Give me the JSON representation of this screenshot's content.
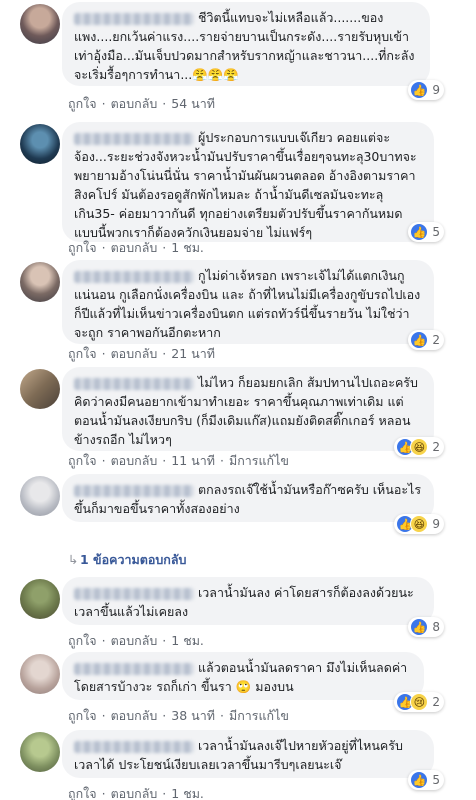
{
  "ui": {
    "like": "ถูกใจ",
    "reply": "ตอบกลับ",
    "dot": "·",
    "edited": "มีการแก้ไข"
  },
  "comments": [
    {
      "text": "ชีวิตนี้แทบจะไม่เหลือแล้ว.......ของแพง....ยกเว้นค่าแรง....รายจ่ายบานเป็นกระดัง....รายรับหุบเข้าเท่าอุ้งมือ...มันเจ็บปวดมากสำหรับรากหญ้าและชาวนา....ที่กะลังจะเริ่มรื้อๆการทำนา...😤😤😤",
      "time": "54 นาที",
      "reactions": [
        "like"
      ],
      "count": "9"
    },
    {
      "text": "ผู้ประกอบการแบบเจ๊เกียว คอยแต่จะจ้อง...ระยะช่วงจังหวะน้ำมันปรับราคาขึ้นเรื่อยๆจนทะลุ30บาทจะพยายามอ้างโน่นนี่นั่น ราคาน้ำมันผันผวนตลอด อ้างอิงตามราคาสิงคโปร์ มันต้องรอดูสักพักไหมละ ถ้าน้ำมันดีเซลมันจะทะลุเกิน35- ค่อยมาวากันดี ทุกอย่างเตรียมตัวปรับขึ้นราคากันหมดแบบนี้พวกเราก็ต้องควักเงินยอมจ่าย ไม่แฟร์ๆ",
      "time": "1 ชม.",
      "reactions": [
        "like"
      ],
      "count": "5"
    },
    {
      "text": "กูไม่ด่าเจ้หรอก เพราะเจ้ไม่ได้แตกเงินกูแน่นอน กูเลือกนั่งเครื่องบิน และ ถ้าที่ไหนไม่มีเครื่องกูขับรถไปเอง ก็ปีแล้วที่ไม่เห็นข่าวเครื่องบินตก แต่รถทัวร์นี่ขึ้นรายวัน ไม่ใช่ว่าจะถูก ราคาพอกันอีกตะหาก",
      "time": "21 นาที",
      "reactions": [
        "like"
      ],
      "count": "2"
    },
    {
      "text": "ไม่ไหว ก็ยอมยกเลิก ส้มปทานไปเถอะครับ คิดว่าคงมีคนอยากเข้ามาทำเยอะ ราคาขึ้นคุณภาพเท่าเดิม แต่ตอนน้ำมันลงเงียบกริบ (ก็มีงเดิมแก๊ส)แถมยังติดสติ๊กเกอร์ หลอนข้างรถอีก ไม่ไหวๆ",
      "time": "11 นาที",
      "edited": true,
      "reactions": [
        "like",
        "haha"
      ],
      "count": "2"
    },
    {
      "text": "ตกลงรถเจ๊ใช้น้ำมันหรือก๊าซครับ เห็นอะไรขึ้นก็มาขอขึ้นราคาทั้งสองอย่าง",
      "reactions": [
        "like",
        "haha"
      ],
      "count": "9",
      "replies": "1 ข้อความตอบกลับ"
    },
    {
      "text": "เวลาน้ำมันลง ค่าโดยสารก็ต้องลงด้วยนะ เวลาขึ้นแล้วไม่เคยลง",
      "time": "1 ชม.",
      "reactions": [
        "like"
      ],
      "count": "8"
    },
    {
      "text": "แล้วตอนน้ำมันลดราคา มึงไม่เห็นลดค่าโดยสารบ้างวะ รถก็เก่า ขี้นรา 🙄 มองบน",
      "time": "38 นาที",
      "edited": true,
      "reactions": [
        "like",
        "sad"
      ],
      "count": "2"
    },
    {
      "text": "เวลาน้ำมันลงเจ๊ไปหายหัวอยู่ที่ไหนครับเวลาได้ ประโยชน์เงียบเลยเวลาขึ้นมารีบๆเลยนะเจ๊",
      "time": "1 ชม.",
      "reactions": [
        "like"
      ],
      "count": "5"
    }
  ],
  "colors": {
    "bubble": "#f2f3f5",
    "link": "#616770",
    "like_blue": "#3b76e9",
    "reply_blue": "#385898"
  }
}
